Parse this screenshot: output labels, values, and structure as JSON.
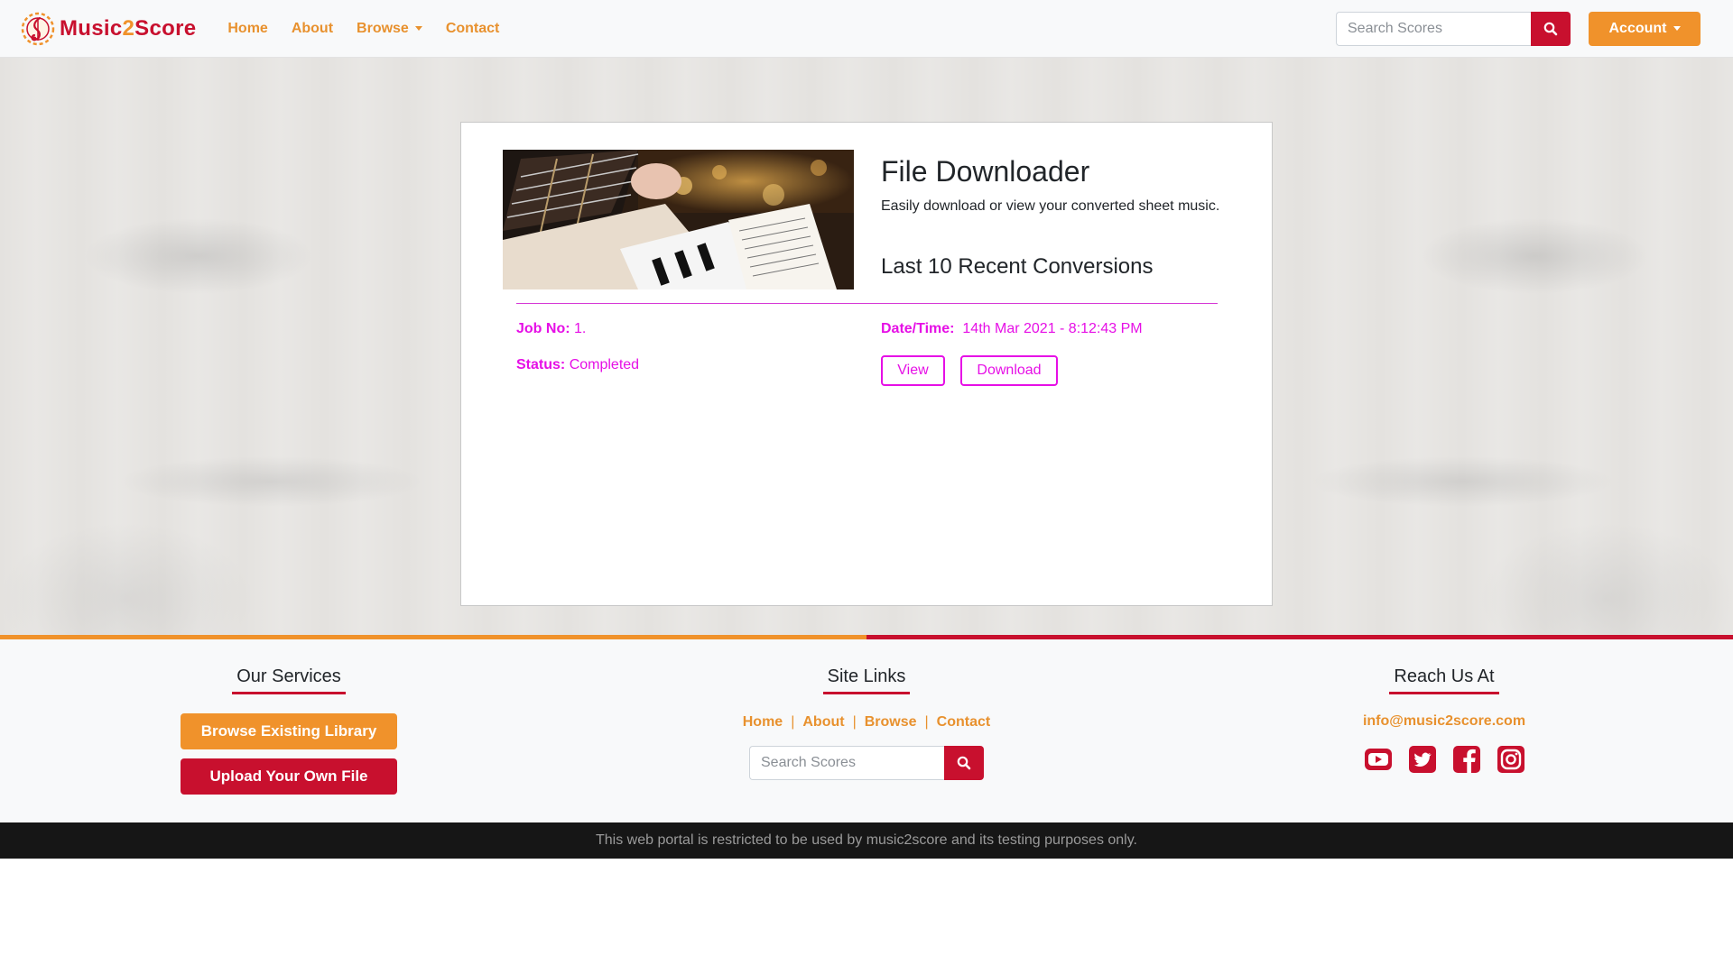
{
  "brand": {
    "name_part1": "Music",
    "name_part2": "2",
    "name_part3": "Score"
  },
  "nav": {
    "items": [
      {
        "label": "Home"
      },
      {
        "label": "About"
      },
      {
        "label": "Browse"
      },
      {
        "label": "Contact"
      }
    ],
    "search_placeholder": "Search Scores",
    "account_label": "Account"
  },
  "card": {
    "title": "File Downloader",
    "subtitle": "Easily download or view your converted sheet music.",
    "recent_heading": "Last 10 Recent Conversions",
    "job": {
      "job_no_label": "Job No:",
      "job_no_value": "1.",
      "datetime_label": "Date/Time:",
      "datetime_value": "14th Mar 2021 - 8:12:43 PM",
      "status_label": "Status:",
      "status_value": "Completed",
      "view_label": "View",
      "download_label": "Download"
    }
  },
  "footer": {
    "services_heading": "Our Services",
    "browse_library_label": "Browse Existing Library",
    "upload_label": "Upload Your Own File",
    "site_links_heading": "Site Links",
    "site_links": [
      {
        "label": "Home"
      },
      {
        "label": "About"
      },
      {
        "label": "Browse"
      },
      {
        "label": "Contact"
      }
    ],
    "search_placeholder": "Search Scores",
    "reach_heading": "Reach Us At",
    "email": "info@music2score.com",
    "socials": [
      "youtube-icon",
      "twitter-icon",
      "facebook-icon",
      "instagram-icon"
    ],
    "copyright": "This web portal is restricted to be used by music2score and its testing purposes only."
  },
  "colors": {
    "brand_red": "#c8102e",
    "brand_orange": "#f0922b",
    "link_orange": "#e8912e",
    "job_magenta": "#e60fe6"
  }
}
